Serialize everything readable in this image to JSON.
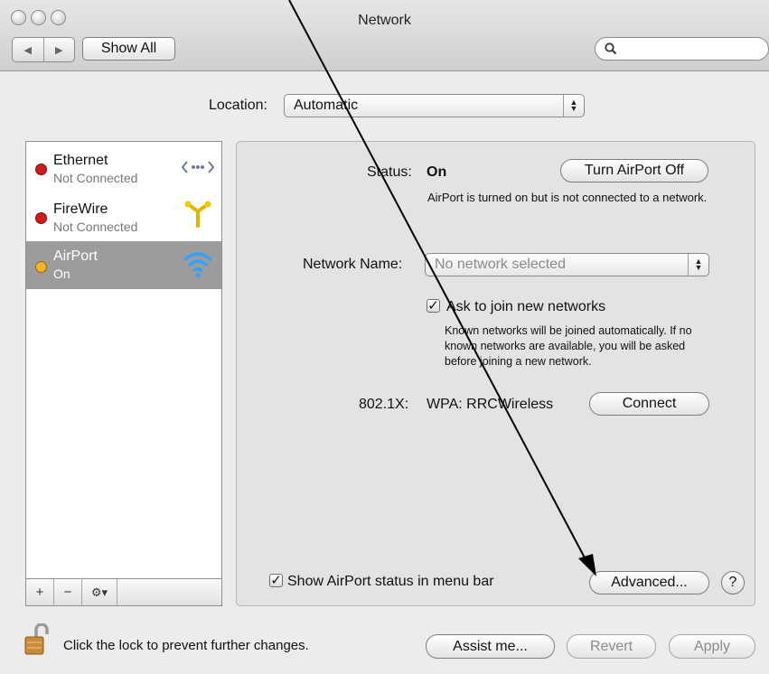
{
  "window": {
    "title": "Network"
  },
  "toolbar": {
    "back_icon": "left-arrow",
    "forward_icon": "right-arrow",
    "show_all_label": "Show All",
    "search_placeholder": ""
  },
  "location": {
    "label": "Location:",
    "value": "Automatic"
  },
  "services": [
    {
      "name": "Ethernet",
      "status": "Not Connected",
      "status_color": "#d11a1a",
      "icon": "ethernet-icon"
    },
    {
      "name": "FireWire",
      "status": "Not Connected",
      "status_color": "#d11a1a",
      "icon": "firewire-icon"
    },
    {
      "name": "AirPort",
      "status": "On",
      "status_color": "#f0b429",
      "icon": "wifi-icon",
      "selected": true
    }
  ],
  "sidebar_controls": {
    "add": "+",
    "remove": "−",
    "action": "⚙▾"
  },
  "detail": {
    "status_label": "Status:",
    "status_value": "On",
    "turn_off_button": "Turn AirPort Off",
    "status_description": "AirPort is turned on but is not connected to a network.",
    "network_name_label": "Network Name:",
    "network_name_placeholder": "No network selected",
    "ask_join_label": "Ask to join new networks",
    "ask_join_checked": true,
    "ask_join_description": "Known networks will be joined automatically. If no known networks are available, you will be asked before joining a new network.",
    "auth_label": "802.1X:",
    "auth_value": "WPA: RRCWireless",
    "connect_button": "Connect",
    "show_status_label": "Show AirPort status in menu bar",
    "show_status_checked": true,
    "advanced_button": "Advanced...",
    "help_label": "?"
  },
  "footer": {
    "lock_text": "Click the lock to prevent further changes.",
    "assist_button": "Assist me...",
    "revert_button": "Revert",
    "apply_button": "Apply"
  }
}
